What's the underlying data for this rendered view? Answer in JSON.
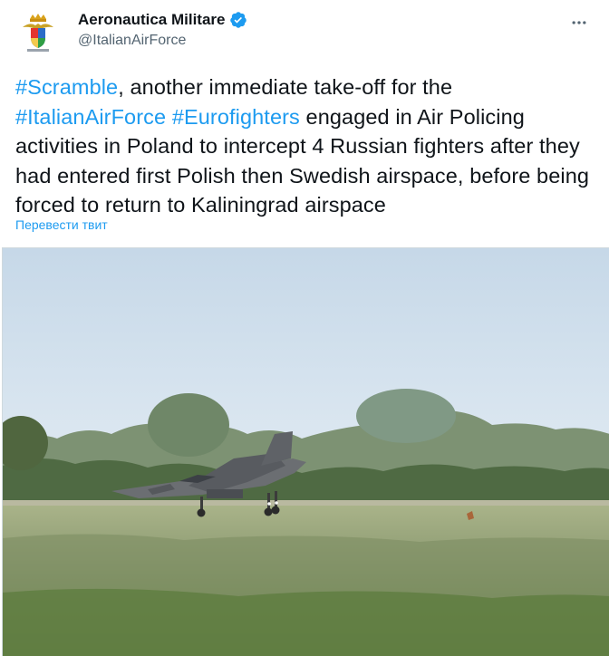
{
  "author": {
    "display_name": "Aeronautica Militare",
    "handle": "@ItalianAirForce",
    "verified": true,
    "avatar_icon": "italian-air-force-crest"
  },
  "tweet": {
    "segments": [
      {
        "text": "#Scramble",
        "type": "hashtag"
      },
      {
        "text": ", another immediate take-off for the ",
        "type": "text"
      },
      {
        "text": "#ItalianAirForce",
        "type": "hashtag"
      },
      {
        "text": " ",
        "type": "text"
      },
      {
        "text": "#Eurofighters",
        "type": "hashtag"
      },
      {
        "text": " engaged in Air Policing activities in Poland to intercept 4 Russian fighters after they had entered first Polish then Swedish airspace, before being forced to return to Kaliningrad airspace",
        "type": "text"
      }
    ],
    "translate_label": "Перевести твит"
  },
  "media": {
    "icon": "eurofighter-landing-photo"
  },
  "colors": {
    "link": "#1d9bf0",
    "verified": "#1d9bf0",
    "text": "#0f1419",
    "secondary": "#536471"
  },
  "icons": {
    "more": "more-icon",
    "verified": "verified-badge-icon"
  }
}
